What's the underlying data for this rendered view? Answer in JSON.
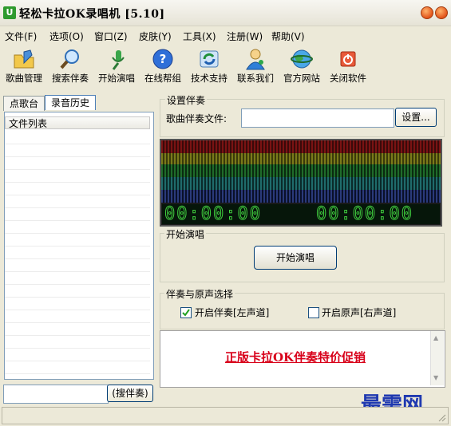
{
  "window": {
    "title": "轻松卡拉OK录唱机 [5.10]"
  },
  "menu": [
    "文件(F)",
    "选项(O)",
    "窗口(Z)",
    "皮肤(Y)",
    "工具(X)",
    "注册(W)",
    "帮助(V)"
  ],
  "toolbar": [
    {
      "label": "歌曲管理",
      "icon": "folder-edit-icon"
    },
    {
      "label": "搜索伴奏",
      "icon": "magnifier-icon"
    },
    {
      "label": "开始演唱",
      "icon": "microphone-icon"
    },
    {
      "label": "在线帮组",
      "icon": "help-icon"
    },
    {
      "label": "技术支持",
      "icon": "support-refresh-icon"
    },
    {
      "label": "联系我们",
      "icon": "contact-person-icon"
    },
    {
      "label": "官方网站",
      "icon": "globe-icon"
    },
    {
      "label": "关闭软件",
      "icon": "power-icon"
    }
  ],
  "left_panel": {
    "tabs": [
      "点歌台",
      "录音历史"
    ],
    "active_tab": "录音历史",
    "list_header": "文件列表",
    "search_value": "",
    "search_button": "搜伴奏"
  },
  "setup": {
    "group_label": "设置伴奏",
    "file_label": "歌曲伴奏文件:",
    "file_value": "",
    "button": "设置..."
  },
  "display": {
    "timer_left": "00:00:00",
    "timer_right": "00:00:00"
  },
  "sing": {
    "group_label": "开始演唱",
    "button": "开始演唱"
  },
  "mix": {
    "group_label": "伴奏与原声选择",
    "opt1": "开启伴奏[左声道]",
    "opt1_checked": true,
    "opt2": "开启原声[右声道]",
    "opt2_checked": false
  },
  "ad": {
    "text": "正版卡拉OK伴奏特价促销"
  },
  "watermark": "最需网",
  "colors": {
    "accent_red": "#d8001a",
    "watermark_blue": "#1f39b0",
    "timer_green": "#3fd13f"
  }
}
